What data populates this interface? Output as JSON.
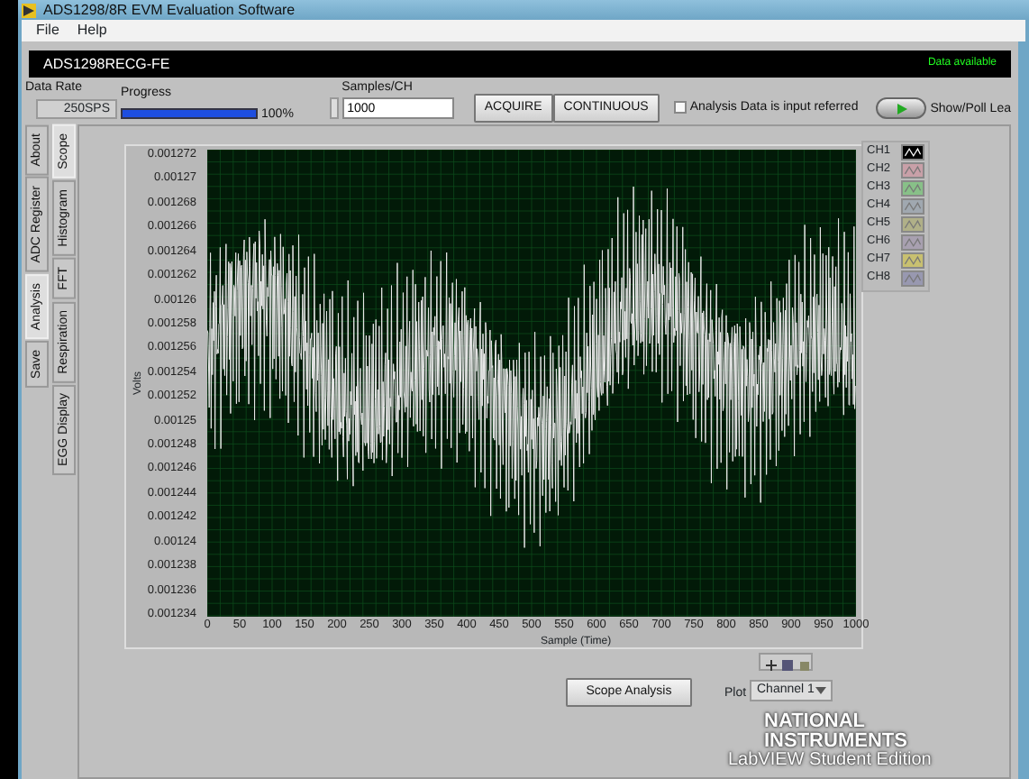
{
  "window": {
    "title": "ADS1298/8R EVM Evaluation Software"
  },
  "menu": [
    "File",
    "Help"
  ],
  "header": {
    "device": "ADS1298RECG-FE",
    "status": "Data available"
  },
  "controls": {
    "data_rate": {
      "label": "Data Rate",
      "value": "250SPS"
    },
    "progress": {
      "label": "Progress",
      "level": 1.0,
      "reading": "100%"
    },
    "samples": {
      "label": "Samples/CH",
      "value": "1000"
    },
    "buttons": [
      "ACQUIRE",
      "CONTINUOUS"
    ],
    "input_referred": {
      "label": "Analysis Data is input referred",
      "checked": false
    },
    "show_poll": {
      "label": "Show/Poll Lea",
      "on": true
    }
  },
  "outer_tabs": [
    {
      "label": "About",
      "selected": false
    },
    {
      "label": "ADC Register",
      "selected": false
    },
    {
      "label": "Analysis",
      "selected": true
    },
    {
      "label": "Save",
      "selected": false
    }
  ],
  "inner_tabs": [
    {
      "label": "Scope",
      "selected": true
    },
    {
      "label": "Histogram",
      "selected": false
    },
    {
      "label": "FFT",
      "selected": false
    },
    {
      "label": "Respiration",
      "selected": false
    },
    {
      "label": "EGG Display",
      "selected": false
    }
  ],
  "graph": {
    "ylabel": "Volts",
    "xlabel": "Sample (Time)",
    "yticks": [
      "0.001272",
      "0.00127",
      "0.001268",
      "0.001266",
      "0.001264",
      "0.001262",
      "0.00126",
      "0.001258",
      "0.001256",
      "0.001254",
      "0.001252",
      "0.00125",
      "0.001248",
      "0.001246",
      "0.001244",
      "0.001242",
      "0.00124",
      "0.001238",
      "0.001236",
      "0.001234"
    ],
    "xticks": [
      "0",
      "50",
      "100",
      "150",
      "200",
      "250",
      "300",
      "350",
      "400",
      "450",
      "500",
      "550",
      "600",
      "650",
      "700",
      "750",
      "800",
      "850",
      "900",
      "950",
      "1000"
    ]
  },
  "legend": [
    {
      "label": "CH1",
      "color": "#000000"
    },
    {
      "label": "CH2",
      "color": "#c8a0a8"
    },
    {
      "label": "CH3",
      "color": "#88c088"
    },
    {
      "label": "CH4",
      "color": "#a0a8b0"
    },
    {
      "label": "CH5",
      "color": "#b0b088"
    },
    {
      "label": "CH6",
      "color": "#a8a0b0"
    },
    {
      "label": "CH7",
      "color": "#c8c070"
    },
    {
      "label": "CH8",
      "color": "#9898b0"
    }
  ],
  "scope_button": "Scope Analysis",
  "plot": {
    "label": "Plot",
    "value": "Channel 1"
  },
  "branding": {
    "line_1": "NATIONAL",
    "line_2": "INSTRUMENTS",
    "line_3": "LabVIEW  Student Edition"
  }
}
